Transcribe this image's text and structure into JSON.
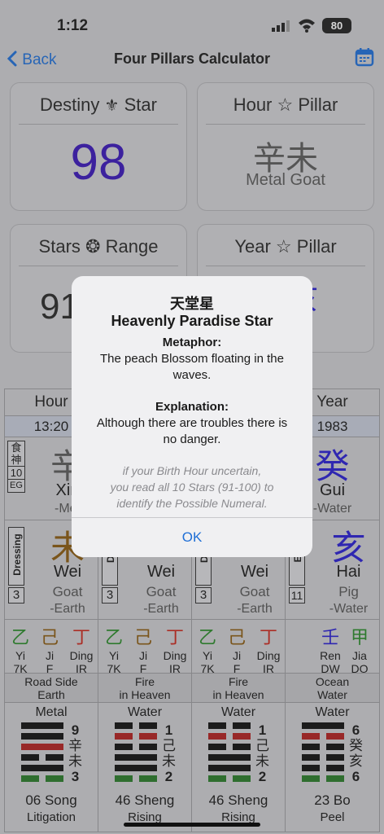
{
  "status": {
    "time": "1:12",
    "battery": "80"
  },
  "nav": {
    "back_label": "Back",
    "title": "Four Pillars Calculator"
  },
  "cards": {
    "destiny": {
      "title_left": "Destiny",
      "title_right": "Star",
      "value": "98"
    },
    "hour_pillar": {
      "title_left": "Hour",
      "title_right": "Pillar",
      "hanzi": "辛未",
      "label": "Metal Goat"
    },
    "stars_range": {
      "title_left": "Stars",
      "title_right": "Range",
      "value_partial": "91"
    },
    "year_pillar": {
      "title_left": "Year",
      "title_right": "Pillar",
      "hanzi_partial": "亥",
      "label_partial": "ig"
    }
  },
  "table": {
    "headers": {
      "hour": "Hour",
      "year": "Year"
    },
    "times": {
      "hour": "13:20",
      "year": "1983"
    },
    "stem_row": {
      "col0": {
        "badge": [
          "食",
          "神",
          "10",
          "EG"
        ],
        "hanzi": "辛",
        "pinyin": "Xin",
        "element": "-Met"
      },
      "col3": {
        "hanzi": "癸",
        "pinyin": "Gui",
        "element": "-Water"
      }
    },
    "branch_row": [
      {
        "tag": "Dressing",
        "num": "3",
        "hanzi": "未",
        "pinyin": "Wei",
        "animal": "Goat",
        "element": "-Earth"
      },
      {
        "tag": "Dre",
        "num": "3",
        "pinyin": "Wei",
        "animal": "Goat",
        "element": "-Earth"
      },
      {
        "tag": "Dre",
        "num": "3",
        "pinyin": "Wei",
        "animal": "Goat",
        "element": "-Earth"
      },
      {
        "tag": "Em",
        "num": "11",
        "hanzi": "亥",
        "pinyin": "Hai",
        "animal": "Pig",
        "element": "-Water"
      }
    ],
    "hidden_row": [
      {
        "items": [
          {
            "h": "乙",
            "p": "Yi",
            "c": "7K"
          },
          {
            "h": "己",
            "p": "Ji",
            "c": "F"
          },
          {
            "h": "丁",
            "p": "Ding",
            "c": "IR"
          }
        ]
      },
      {
        "items": [
          {
            "h": "乙",
            "p": "Yi",
            "c": "7K"
          },
          {
            "h": "己",
            "p": "Ji",
            "c": "F"
          },
          {
            "h": "丁",
            "p": "Ding",
            "c": "IR"
          }
        ]
      },
      {
        "items": [
          {
            "h": "乙",
            "p": "Yi",
            "c": "7K"
          },
          {
            "h": "己",
            "p": "Ji",
            "c": "F"
          },
          {
            "h": "丁",
            "p": "Ding",
            "c": "IR"
          }
        ]
      },
      {
        "items": [
          {
            "h": "壬",
            "p": "Ren",
            "c": "DW"
          },
          {
            "h": "甲",
            "p": "Jia",
            "c": "DO"
          }
        ]
      }
    ],
    "nayin_row": [
      {
        "l1": "Road Side",
        "l2": "Earth"
      },
      {
        "l1": "Fire",
        "l2": "in Heaven"
      },
      {
        "l1": "Fire",
        "l2": "in Heaven"
      },
      {
        "l1": "Ocean",
        "l2": "Water"
      }
    ],
    "hex_row": [
      {
        "element": "Metal",
        "side": [
          "9",
          "辛",
          "未",
          "3"
        ],
        "name": "06 Song",
        "meaning": "Litigation"
      },
      {
        "element": "Water",
        "side": [
          "1",
          "己",
          "未",
          "2"
        ],
        "name": "46 Sheng",
        "meaning": "Rising"
      },
      {
        "element": "Water",
        "side": [
          "1",
          "己",
          "未",
          "2"
        ],
        "name": "46 Sheng",
        "meaning": "Rising"
      },
      {
        "element": "Water",
        "side": [
          "6",
          "癸",
          "亥",
          "6"
        ],
        "name": "23 Bo",
        "meaning": "Peel"
      }
    ]
  },
  "alert": {
    "title_cn": "天堂星",
    "title_en": "Heavenly Paradise Star",
    "metaphor_label": "Metaphor:",
    "metaphor_l1": "The peach Blossom floating in the",
    "metaphor_l2": "waves.",
    "explanation_label": "Explanation:",
    "explanation_l1": "Although there are troubles there is",
    "explanation_l2": "no danger.",
    "note_l1": "if your Birth Hour uncertain,",
    "note_l2": "you read all 10 Stars (91-100) to",
    "note_l3": "identify the Possible Numeral.",
    "ok_label": "OK"
  },
  "colors": {
    "accent": "#1f6fd6",
    "destiny": "#3a18b8",
    "water": "#2a1fd0",
    "earth": "#8a5a10",
    "wood": "#2a8a2a",
    "fire": "#c8281e"
  }
}
